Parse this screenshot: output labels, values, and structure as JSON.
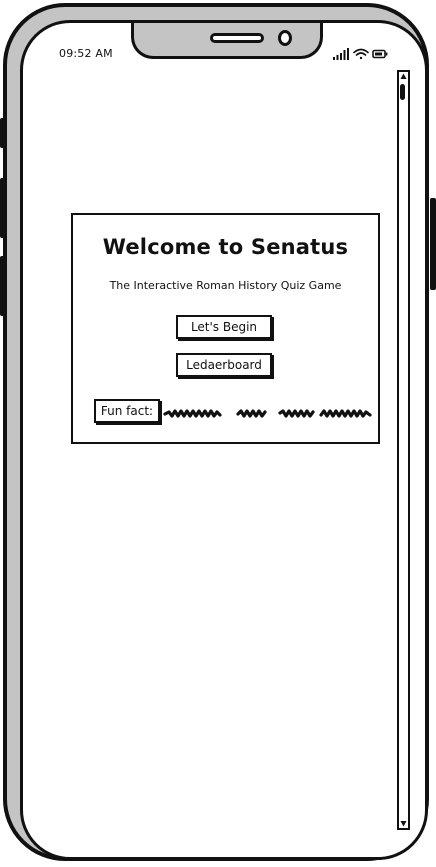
{
  "status_bar": {
    "time": "09:52 AM",
    "icons": [
      "signal-icon",
      "wifi-icon",
      "battery-icon"
    ]
  },
  "welcome_card": {
    "title": "Welcome to Senatus",
    "subtitle": "The Interactive Roman History Quiz Game",
    "begin_button_label": "Let's Begin",
    "leaderboard_button_label": "Ledaerboard",
    "fun_fact_label": "Fun fact:"
  },
  "colors": {
    "ink": "#111111",
    "device_frame": "#c4c4c4",
    "screen": "#ffffff"
  }
}
